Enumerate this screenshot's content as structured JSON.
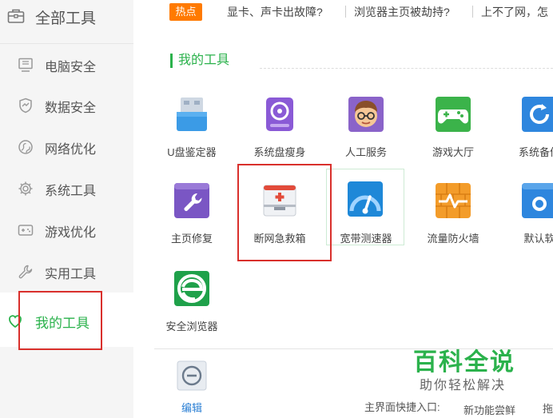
{
  "sidebar": {
    "header": {
      "label": "全部工具",
      "icon": "toolbox-icon"
    },
    "items": [
      {
        "label": "电脑安全",
        "icon": "monitor-icon"
      },
      {
        "label": "数据安全",
        "icon": "shield-icon"
      },
      {
        "label": "网络优化",
        "icon": "network-icon"
      },
      {
        "label": "系统工具",
        "icon": "gear-icon"
      },
      {
        "label": "游戏优化",
        "icon": "gamepad-icon"
      },
      {
        "label": "实用工具",
        "icon": "wrench-icon"
      },
      {
        "label": "我的工具",
        "icon": "heart-icon",
        "active": true
      }
    ]
  },
  "hotbar": {
    "tag": "热点",
    "links": [
      "显卡、声卡出故障?",
      "浏览器主页被劫持?",
      "上不了网，怎"
    ]
  },
  "section": {
    "title": "我的工具"
  },
  "tools": [
    {
      "label": "U盘鉴定器",
      "icon": "usb-icon"
    },
    {
      "label": "系统盘瘦身",
      "icon": "disk-icon"
    },
    {
      "label": "人工服务",
      "icon": "support-agent-icon"
    },
    {
      "label": "游戏大厅",
      "icon": "game-hall-icon"
    },
    {
      "label": "系统备份",
      "icon": "backup-icon"
    },
    {
      "label": "主页修复",
      "icon": "homepage-repair-icon"
    },
    {
      "label": "断网急救箱",
      "icon": "first-aid-kit-icon"
    },
    {
      "label": "宽带测速器",
      "icon": "speed-test-icon"
    },
    {
      "label": "流量防火墙",
      "icon": "firewall-icon"
    },
    {
      "label": "默认软",
      "icon": "default-software-icon"
    },
    {
      "label": "安全浏览器",
      "icon": "secure-browser-icon"
    }
  ],
  "bottom": {
    "edit_label": "编辑",
    "shortcut_label": "主界面快捷入口:",
    "new_feature_label": "新功能尝鲜",
    "drag_label": "拖"
  },
  "watermark": {
    "title": "百科全说",
    "subtitle": "助你轻松解决"
  },
  "colors": {
    "accent": "#2bb24c",
    "hot": "#ff7a00",
    "highlight": "#d9302c",
    "link": "#2a7fd4"
  }
}
